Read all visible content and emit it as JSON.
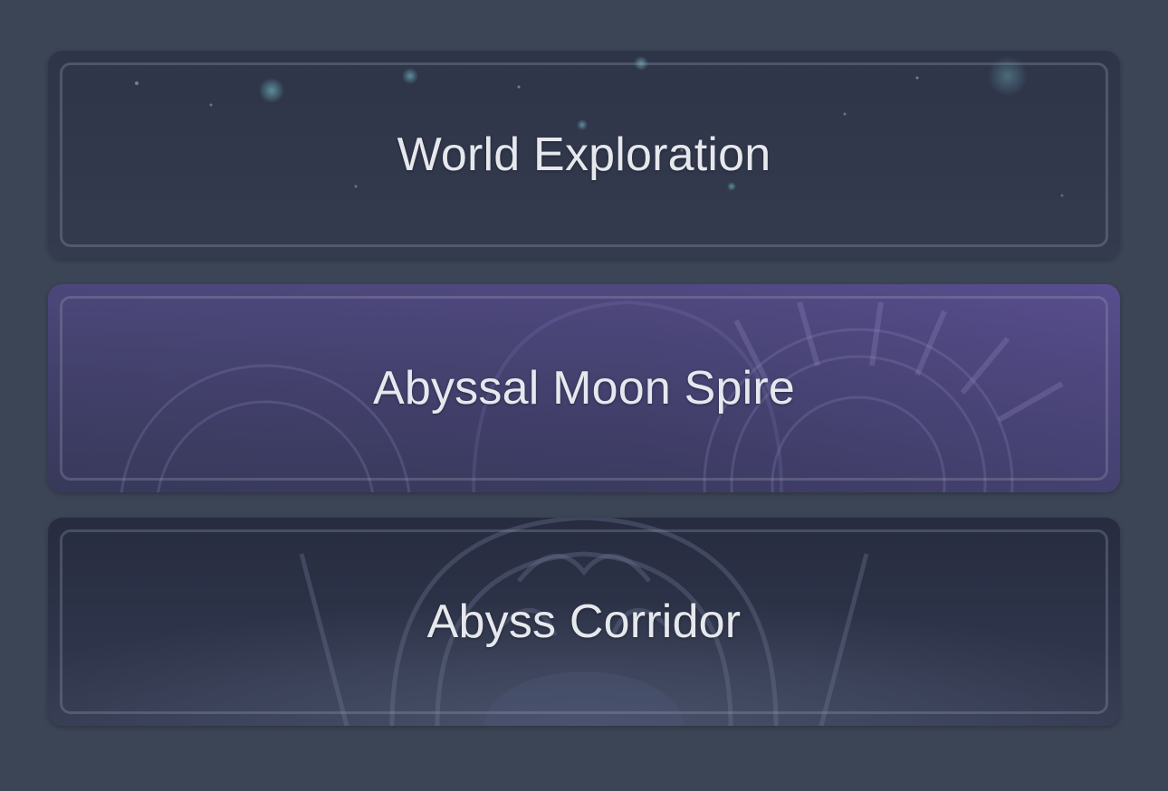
{
  "menu": {
    "items": [
      {
        "label": "World Exploration"
      },
      {
        "label": "Abyssal Moon Spire"
      },
      {
        "label": "Abyss Corridor"
      }
    ]
  },
  "colors": {
    "page_background": "#3c4556",
    "card_world": "#2e3448",
    "card_spire": "#463f6e",
    "card_corridor": "#2b3044",
    "label_text": "#e6e8ee"
  }
}
